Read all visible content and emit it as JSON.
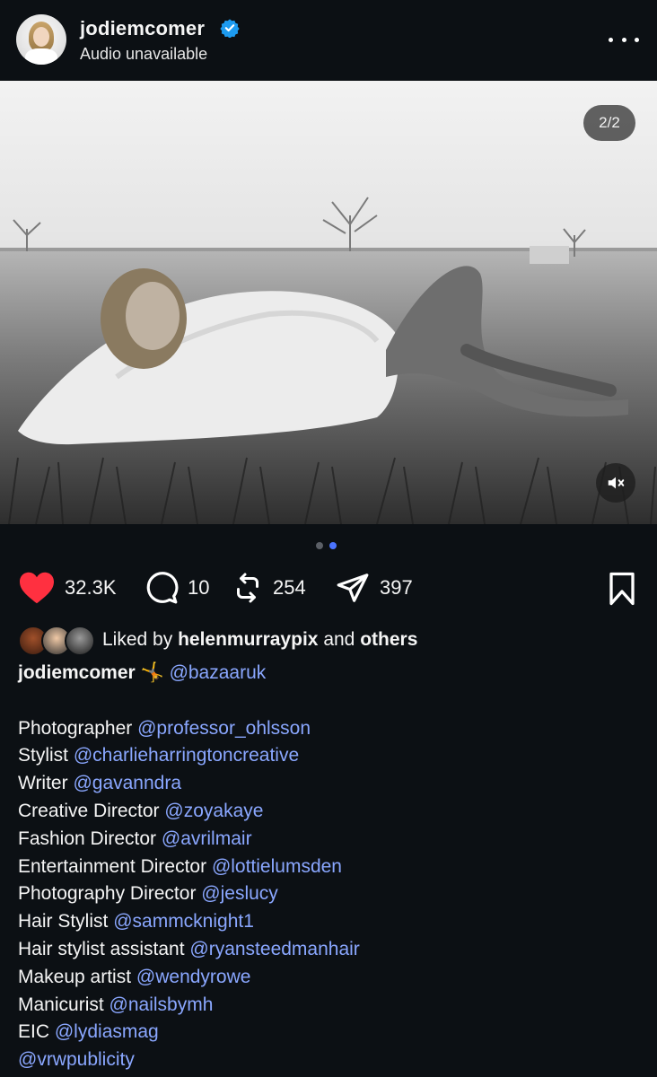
{
  "header": {
    "username": "jodiemcomer",
    "subtitle": "Audio unavailable",
    "verified_icon": "verified-badge-icon",
    "more_icon": "more-options-icon",
    "accent": "#1d9bf0"
  },
  "media": {
    "counter": "2/2",
    "mute_icon": "speaker-muted-icon"
  },
  "carousel": {
    "pages": 2,
    "current": 2
  },
  "actions": {
    "likes": "32.3K",
    "comments": "10",
    "reposts": "254",
    "shares": "397",
    "like_color": "#ff3040"
  },
  "liked_by": {
    "prefix": "Liked by",
    "user": "helenmurraypix",
    "conjunction": "and",
    "others": "others"
  },
  "caption": {
    "author": "jodiemcomer",
    "emoji": "🤸",
    "tag": "@bazaaruk",
    "credits": [
      {
        "role": "Photographer",
        "handle": "@professor_ohlsson"
      },
      {
        "role": "Stylist",
        "handle": "@charlieharringtoncreative"
      },
      {
        "role": "Writer",
        "handle": "@gavanndra"
      },
      {
        "role": "Creative Director",
        "handle": "@zoyakaye"
      },
      {
        "role": "Fashion Director",
        "handle": "@avrilmair"
      },
      {
        "role": "Entertainment Director",
        "handle": "@lottielumsden"
      },
      {
        "role": "Photography Director",
        "handle": "@jeslucy"
      },
      {
        "role": "Hair Stylist",
        "handle": "@sammcknight1"
      },
      {
        "role": "Hair stylist assistant",
        "handle": "@ryansteedmanhair"
      },
      {
        "role": "Makeup artist",
        "handle": "@wendyrowe"
      },
      {
        "role": "Manicurist",
        "handle": "@nailsbymh"
      },
      {
        "role": "EIC",
        "handle": "@lydiasmag"
      },
      {
        "role": "",
        "handle": "@vrwpublicity"
      }
    ],
    "mention_color": "#8aa7ff"
  }
}
